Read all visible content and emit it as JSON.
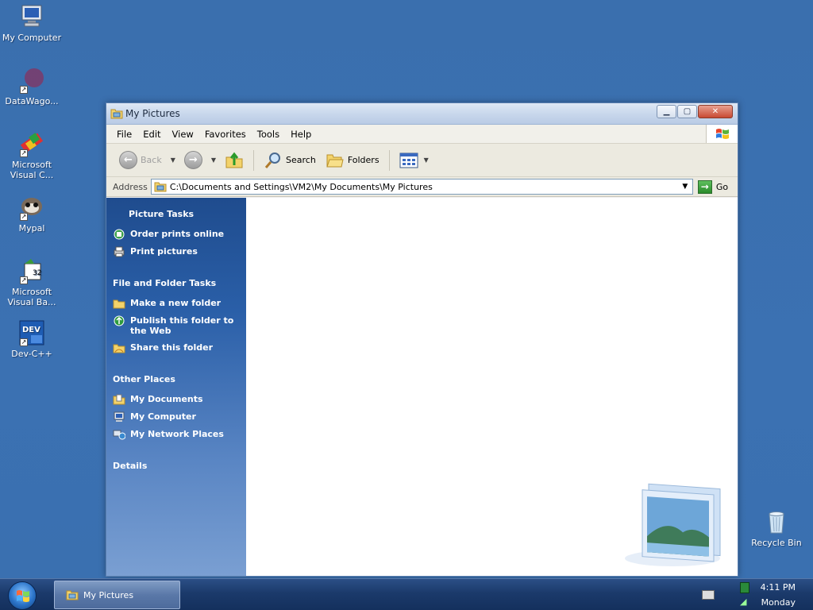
{
  "desktop": {
    "icons": [
      {
        "label": "My Computer",
        "icon": "computer-icon"
      },
      {
        "label": "DataWago...",
        "icon": "datawagon-icon"
      },
      {
        "label": "Microsoft Visual C...",
        "icon": "visual-c-icon"
      },
      {
        "label": "Mypal",
        "icon": "mypal-icon"
      },
      {
        "label": "Microsoft Visual Ba...",
        "icon": "visual-basic-icon"
      },
      {
        "label": "Dev-C++",
        "icon": "dev-cpp-icon"
      }
    ],
    "recycle_bin": "Recycle Bin"
  },
  "window": {
    "title": "My Pictures",
    "menu": [
      "File",
      "Edit",
      "View",
      "Favorites",
      "Tools",
      "Help"
    ],
    "toolbar": {
      "back": "Back",
      "search": "Search",
      "folders": "Folders"
    },
    "address": {
      "label": "Address",
      "value": "C:\\Documents and Settings\\VM2\\My Documents\\My Pictures",
      "go": "Go"
    },
    "task_pane": {
      "picture_tasks": {
        "title": "Picture Tasks",
        "items": [
          "Order prints online",
          "Print pictures"
        ]
      },
      "file_folder_tasks": {
        "title": "File and Folder Tasks",
        "items": [
          "Make a new folder",
          "Publish this folder to the Web",
          "Share this folder"
        ]
      },
      "other_places": {
        "title": "Other Places",
        "items": [
          "My Documents",
          "My Computer",
          "My Network Places"
        ]
      },
      "details": {
        "title": "Details"
      }
    }
  },
  "taskbar": {
    "task_item": "My Pictures",
    "time": "4:11 PM",
    "day": "Monday"
  }
}
